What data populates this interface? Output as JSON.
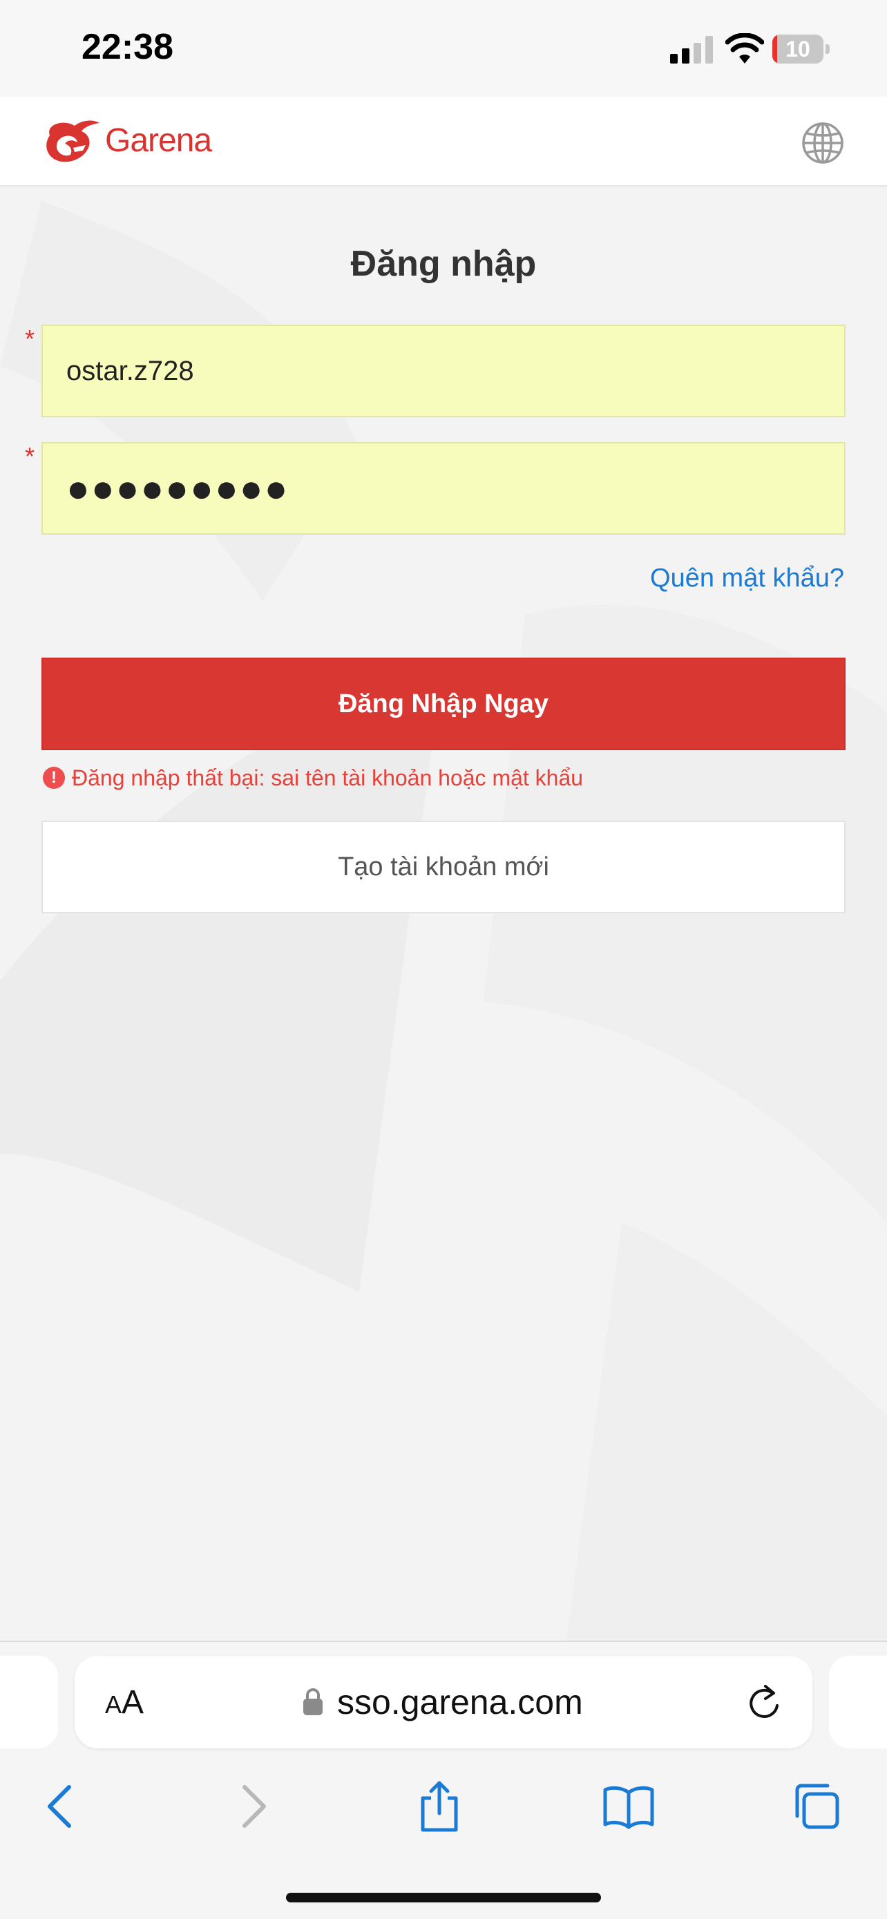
{
  "status_bar": {
    "time": "22:38",
    "battery_level": "10",
    "battery_fraction": 0.1,
    "battery_color": "#e8322e"
  },
  "header": {
    "brand": "Garena",
    "brand_color": "#d9342f",
    "language_icon": "globe-icon"
  },
  "login": {
    "title": "Đăng nhập",
    "required_mark": "*",
    "username_value": "ostar.z728",
    "password_value": "●●●●●●●●●",
    "forgot_link": "Quên mật khẩu?",
    "submit_label": "Đăng Nhập Ngay",
    "error_icon": "!",
    "error_message": "Đăng nhập thất bại: sai tên tài khoản hoặc mật khẩu",
    "create_account_label": "Tạo tài khoản mới",
    "accent_color": "#d93731",
    "link_color": "#1a7ad4",
    "autofill_color": "#f7fcbd"
  },
  "browser": {
    "text_size_small": "A",
    "text_size_large": "A",
    "url": "sso.garena.com",
    "icons": [
      "lock-icon",
      "reload-icon",
      "back-icon",
      "forward-icon",
      "share-icon",
      "bookmarks-icon",
      "tabs-icon"
    ],
    "tint_color": "#1a7ad4"
  }
}
